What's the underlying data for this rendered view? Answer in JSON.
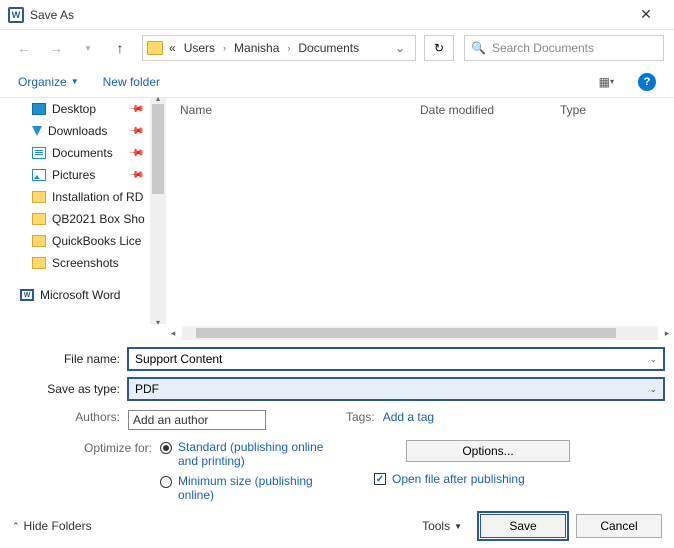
{
  "window": {
    "title": "Save As"
  },
  "nav": {
    "path": {
      "prefix": "«",
      "seg1": "Users",
      "seg2": "Manisha",
      "seg3": "Documents"
    },
    "search_placeholder": "Search Documents"
  },
  "toolbar": {
    "organize": "Organize",
    "newfolder": "New folder"
  },
  "columns": {
    "name": "Name",
    "date": "Date modified",
    "type": "Type"
  },
  "sidebar": {
    "items": [
      {
        "label": "Desktop",
        "pinned": true
      },
      {
        "label": "Downloads",
        "pinned": true
      },
      {
        "label": "Documents",
        "pinned": true
      },
      {
        "label": "Pictures",
        "pinned": true
      },
      {
        "label": "Installation of RD",
        "pinned": false
      },
      {
        "label": "QB2021 Box Sho",
        "pinned": false
      },
      {
        "label": "QuickBooks Lice",
        "pinned": false
      },
      {
        "label": "Screenshots",
        "pinned": false
      }
    ],
    "bottom": "Microsoft Word"
  },
  "form": {
    "filename_label": "File name:",
    "filename_value": "Support Content",
    "saveastype_label": "Save as type:",
    "saveastype_value": "PDF",
    "authors_label": "Authors:",
    "authors_value": "Add an author",
    "tags_label": "Tags:",
    "tags_value": "Add a tag",
    "optimize_label": "Optimize for:",
    "opt_standard": "Standard (publishing online and printing)",
    "opt_minimum": "Minimum size (publishing online)",
    "options_btn": "Options...",
    "openafter": "Open file after publishing"
  },
  "footer": {
    "hidefolders": "Hide Folders",
    "tools": "Tools",
    "save": "Save",
    "cancel": "Cancel"
  }
}
